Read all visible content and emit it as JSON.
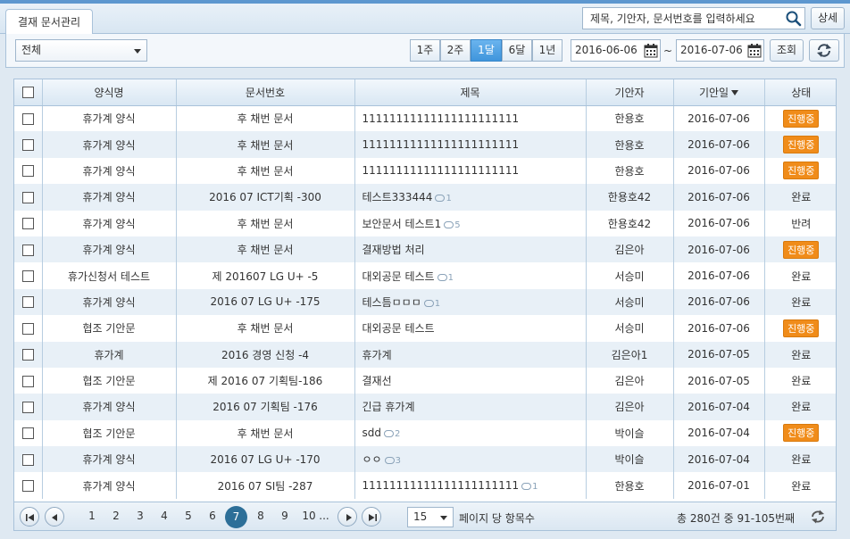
{
  "tab": {
    "label": "결재 문서관리"
  },
  "search": {
    "placeholder": "제목, 기안자, 문서번호를 입력하세요",
    "detail_label": "상세"
  },
  "filter": {
    "selected": "전체"
  },
  "periods": [
    {
      "label": "1주",
      "active": false
    },
    {
      "label": "2주",
      "active": false
    },
    {
      "label": "1달",
      "active": true
    },
    {
      "label": "6달",
      "active": false
    },
    {
      "label": "1년",
      "active": false
    }
  ],
  "date_from": "2016-06-06",
  "date_to": "2016-07-06",
  "date_sep": "~",
  "search_button": "조회",
  "columns": [
    "양식명",
    "문서번호",
    "제목",
    "기안자",
    "기안일",
    "상태"
  ],
  "rows": [
    {
      "form": "휴가계 양식",
      "doc_no": "후 채번 문서",
      "title": "11111111111111111111111",
      "comments": "",
      "drafter": "한용호",
      "date": "2016-07-06",
      "status": "진행중",
      "badge": true
    },
    {
      "form": "휴가계 양식",
      "doc_no": "후 채번 문서",
      "title": "11111111111111111111111",
      "comments": "",
      "drafter": "한용호",
      "date": "2016-07-06",
      "status": "진행중",
      "badge": true
    },
    {
      "form": "휴가계 양식",
      "doc_no": "후 채번 문서",
      "title": "11111111111111111111111",
      "comments": "",
      "drafter": "한용호",
      "date": "2016-07-06",
      "status": "진행중",
      "badge": true
    },
    {
      "form": "휴가계 양식",
      "doc_no": "2016 07 ICT기획 -300",
      "title": "테스트333444",
      "comments": "1",
      "drafter": "한용호42",
      "date": "2016-07-06",
      "status": "완료",
      "badge": false
    },
    {
      "form": "휴가계 양식",
      "doc_no": "후 채번 문서",
      "title": "보안문서 테스트1",
      "comments": "5",
      "drafter": "한용호42",
      "date": "2016-07-06",
      "status": "반려",
      "badge": false
    },
    {
      "form": "휴가계 양식",
      "doc_no": "후 채번 문서",
      "title": "결재방법 처리",
      "comments": "",
      "drafter": "김은아",
      "date": "2016-07-06",
      "status": "진행중",
      "badge": true
    },
    {
      "form": "휴가신청서 테스트",
      "doc_no": "제 201607 LG U+ -5",
      "title": "대외공문 테스트",
      "comments": "1",
      "drafter": "서승미",
      "date": "2016-07-06",
      "status": "완료",
      "badge": false
    },
    {
      "form": "휴가계 양식",
      "doc_no": "2016 07 LG U+ -175",
      "title": "테스틈ㅁㅁㅁ",
      "comments": "1",
      "drafter": "서승미",
      "date": "2016-07-06",
      "status": "완료",
      "badge": false
    },
    {
      "form": "협조 기안문",
      "doc_no": "후 채번 문서",
      "title": "대외공문 테스트",
      "comments": "",
      "drafter": "서승미",
      "date": "2016-07-06",
      "status": "진행중",
      "badge": true
    },
    {
      "form": "휴가계",
      "doc_no": "2016 경영 신청 -4",
      "title": "휴가계",
      "comments": "",
      "drafter": "김은아1",
      "date": "2016-07-05",
      "status": "완료",
      "badge": false
    },
    {
      "form": "협조 기안문",
      "doc_no": "제 2016 07 기획팀-186",
      "title": "결재선",
      "comments": "",
      "drafter": "김은아",
      "date": "2016-07-05",
      "status": "완료",
      "badge": false
    },
    {
      "form": "휴가계 양식",
      "doc_no": "2016 07 기획팀 -176",
      "title": "긴급 휴가계",
      "comments": "",
      "drafter": "김은아",
      "date": "2016-07-04",
      "status": "완료",
      "badge": false
    },
    {
      "form": "협조 기안문",
      "doc_no": "후 채번 문서",
      "title": "sdd",
      "comments": "2",
      "drafter": "박이슬",
      "date": "2016-07-04",
      "status": "진행중",
      "badge": true
    },
    {
      "form": "휴가계 양식",
      "doc_no": "2016 07 LG U+ -170",
      "title": "ㅇㅇ",
      "comments": "3",
      "drafter": "박이슬",
      "date": "2016-07-04",
      "status": "완료",
      "badge": false
    },
    {
      "form": "휴가계 양식",
      "doc_no": "2016 07 SI팀 -287",
      "title": "11111111111111111111111",
      "comments": "1",
      "drafter": "한용호",
      "date": "2016-07-01",
      "status": "완료",
      "badge": false
    }
  ],
  "pagination": {
    "pages": [
      "1",
      "2",
      "3",
      "4",
      "5",
      "6",
      "7",
      "8",
      "9",
      "10"
    ],
    "current": "7",
    "ellipsis": "...",
    "page_size": "15",
    "page_size_label": "페이지 당 항목수",
    "total": "총 280건 중 91-105번째"
  },
  "colors": {
    "accent": "#3f95dc",
    "badge": "#f08c1a",
    "current_page": "#2d6f98",
    "row_alt": "#e8f0f7"
  }
}
